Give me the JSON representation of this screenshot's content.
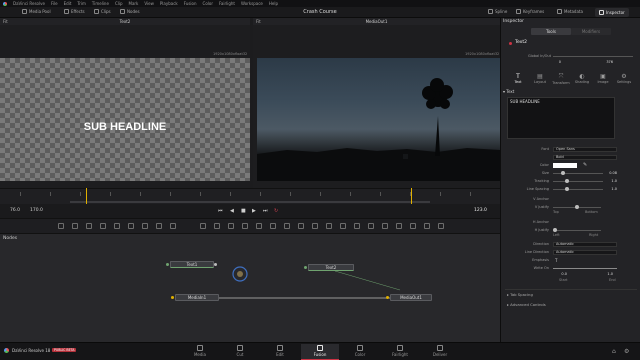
{
  "menu": [
    "DaVinci Resolve",
    "File",
    "Edit",
    "Trim",
    "Timeline",
    "Clip",
    "Mark",
    "View",
    "Playback",
    "Fusion",
    "Color",
    "Fairlight",
    "Workspace",
    "Help"
  ],
  "toolbar": {
    "media_pool": "Media Pool",
    "effects": "Effects",
    "clips": "Clips",
    "nodes": "Nodes",
    "project_title": "Crash Course",
    "spline": "Spline",
    "keyframes": "Keyframes",
    "metadata": "Metadata",
    "inspector": "Inspector"
  },
  "viewer_left": {
    "zoom": "Fit",
    "name": "Text2",
    "resolution": "1920x1080xfloat32"
  },
  "viewer_right": {
    "zoom": "Fit",
    "name": "MediaOut1",
    "resolution": "1920x1080xfloat32"
  },
  "canvas_text": "SUB HEADLINE",
  "transport": {
    "start": "76.0",
    "end": "170.0",
    "current": "123.0"
  },
  "nodes_panel": {
    "label": "Nodes",
    "nodes": [
      "Text1",
      "Text2",
      "MediaIn1",
      "MediaOut1"
    ]
  },
  "inspector": {
    "title": "Inspector",
    "tabs": [
      "Tools",
      "Modifiers"
    ],
    "node_name": "Text2",
    "global_in_out_label": "Global In/Out",
    "global_in": "0",
    "global_out": "376",
    "sub_tabs": [
      "Text",
      "Layout",
      "Transform",
      "Shading",
      "Image",
      "Settings"
    ],
    "section": "Text",
    "styled_text": "SUB HEADLINE",
    "font_label": "Font",
    "font": "Open Sans",
    "style": "Bold",
    "color_label": "Color",
    "size_label": "Size",
    "size": "0.08",
    "tracking_label": "Tracking",
    "tracking": "1.0",
    "line_spacing_label": "Line Spacing",
    "line_spacing": "1.0",
    "v_anchor_label": "V Anchor",
    "v_justify_label": "V Justify",
    "v_justify_options": [
      "Top",
      "Bottom"
    ],
    "h_anchor_label": "H Anchor",
    "h_justify_label": "H Justify",
    "h_justify_options": [
      "Left",
      "Right"
    ],
    "direction_label": "Direction",
    "direction": "Automatic",
    "line_direction_label": "Line Direction",
    "line_direction": "Automatic",
    "emphasis_label": "Emphasis",
    "emphasis": "T",
    "write_on_label": "Write On",
    "write_on_start": "0.0",
    "write_on_end": "1.0",
    "write_on_sublabels": [
      "Start",
      "End"
    ],
    "tab_spacing": "Tab Spacing",
    "advanced_controls": "Advanced Controls"
  },
  "pages": [
    "Media",
    "Cut",
    "Edit",
    "Fusion",
    "Color",
    "Fairlight",
    "Deliver"
  ],
  "active_page": "Fusion",
  "app_name": "DaVinci Resolve 18",
  "app_badge": "PUBLIC BETA",
  "colors": {
    "accent": "#cc3344",
    "playhead": "#e0b000",
    "bg": "#1c1c1e"
  }
}
